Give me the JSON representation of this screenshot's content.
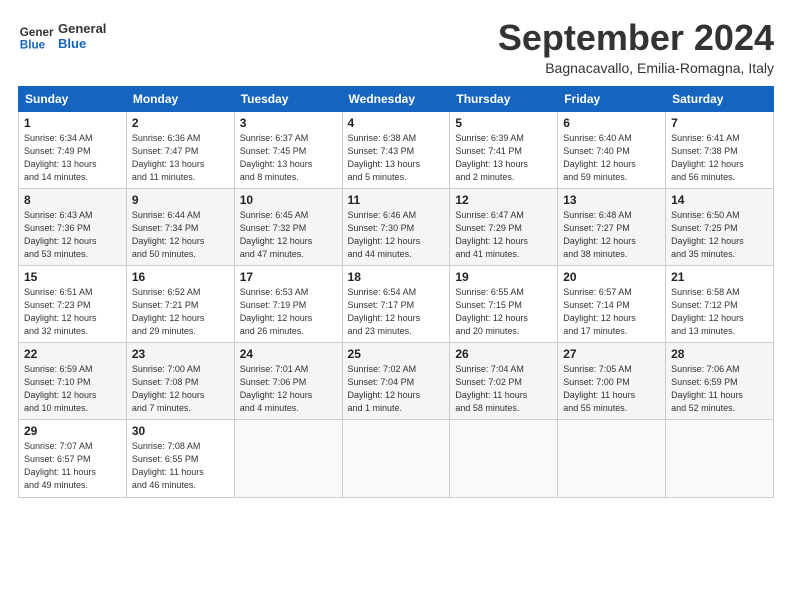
{
  "logo": {
    "line1": "General",
    "line2": "Blue"
  },
  "title": "September 2024",
  "location": "Bagnacavallo, Emilia-Romagna, Italy",
  "days_of_week": [
    "Sunday",
    "Monday",
    "Tuesday",
    "Wednesday",
    "Thursday",
    "Friday",
    "Saturday"
  ],
  "weeks": [
    [
      {
        "day": "1",
        "info": "Sunrise: 6:34 AM\nSunset: 7:49 PM\nDaylight: 13 hours\nand 14 minutes."
      },
      {
        "day": "2",
        "info": "Sunrise: 6:36 AM\nSunset: 7:47 PM\nDaylight: 13 hours\nand 11 minutes."
      },
      {
        "day": "3",
        "info": "Sunrise: 6:37 AM\nSunset: 7:45 PM\nDaylight: 13 hours\nand 8 minutes."
      },
      {
        "day": "4",
        "info": "Sunrise: 6:38 AM\nSunset: 7:43 PM\nDaylight: 13 hours\nand 5 minutes."
      },
      {
        "day": "5",
        "info": "Sunrise: 6:39 AM\nSunset: 7:41 PM\nDaylight: 13 hours\nand 2 minutes."
      },
      {
        "day": "6",
        "info": "Sunrise: 6:40 AM\nSunset: 7:40 PM\nDaylight: 12 hours\nand 59 minutes."
      },
      {
        "day": "7",
        "info": "Sunrise: 6:41 AM\nSunset: 7:38 PM\nDaylight: 12 hours\nand 56 minutes."
      }
    ],
    [
      {
        "day": "8",
        "info": "Sunrise: 6:43 AM\nSunset: 7:36 PM\nDaylight: 12 hours\nand 53 minutes."
      },
      {
        "day": "9",
        "info": "Sunrise: 6:44 AM\nSunset: 7:34 PM\nDaylight: 12 hours\nand 50 minutes."
      },
      {
        "day": "10",
        "info": "Sunrise: 6:45 AM\nSunset: 7:32 PM\nDaylight: 12 hours\nand 47 minutes."
      },
      {
        "day": "11",
        "info": "Sunrise: 6:46 AM\nSunset: 7:30 PM\nDaylight: 12 hours\nand 44 minutes."
      },
      {
        "day": "12",
        "info": "Sunrise: 6:47 AM\nSunset: 7:29 PM\nDaylight: 12 hours\nand 41 minutes."
      },
      {
        "day": "13",
        "info": "Sunrise: 6:48 AM\nSunset: 7:27 PM\nDaylight: 12 hours\nand 38 minutes."
      },
      {
        "day": "14",
        "info": "Sunrise: 6:50 AM\nSunset: 7:25 PM\nDaylight: 12 hours\nand 35 minutes."
      }
    ],
    [
      {
        "day": "15",
        "info": "Sunrise: 6:51 AM\nSunset: 7:23 PM\nDaylight: 12 hours\nand 32 minutes."
      },
      {
        "day": "16",
        "info": "Sunrise: 6:52 AM\nSunset: 7:21 PM\nDaylight: 12 hours\nand 29 minutes."
      },
      {
        "day": "17",
        "info": "Sunrise: 6:53 AM\nSunset: 7:19 PM\nDaylight: 12 hours\nand 26 minutes."
      },
      {
        "day": "18",
        "info": "Sunrise: 6:54 AM\nSunset: 7:17 PM\nDaylight: 12 hours\nand 23 minutes."
      },
      {
        "day": "19",
        "info": "Sunrise: 6:55 AM\nSunset: 7:15 PM\nDaylight: 12 hours\nand 20 minutes."
      },
      {
        "day": "20",
        "info": "Sunrise: 6:57 AM\nSunset: 7:14 PM\nDaylight: 12 hours\nand 17 minutes."
      },
      {
        "day": "21",
        "info": "Sunrise: 6:58 AM\nSunset: 7:12 PM\nDaylight: 12 hours\nand 13 minutes."
      }
    ],
    [
      {
        "day": "22",
        "info": "Sunrise: 6:59 AM\nSunset: 7:10 PM\nDaylight: 12 hours\nand 10 minutes."
      },
      {
        "day": "23",
        "info": "Sunrise: 7:00 AM\nSunset: 7:08 PM\nDaylight: 12 hours\nand 7 minutes."
      },
      {
        "day": "24",
        "info": "Sunrise: 7:01 AM\nSunset: 7:06 PM\nDaylight: 12 hours\nand 4 minutes."
      },
      {
        "day": "25",
        "info": "Sunrise: 7:02 AM\nSunset: 7:04 PM\nDaylight: 12 hours\nand 1 minute."
      },
      {
        "day": "26",
        "info": "Sunrise: 7:04 AM\nSunset: 7:02 PM\nDaylight: 11 hours\nand 58 minutes."
      },
      {
        "day": "27",
        "info": "Sunrise: 7:05 AM\nSunset: 7:00 PM\nDaylight: 11 hours\nand 55 minutes."
      },
      {
        "day": "28",
        "info": "Sunrise: 7:06 AM\nSunset: 6:59 PM\nDaylight: 11 hours\nand 52 minutes."
      }
    ],
    [
      {
        "day": "29",
        "info": "Sunrise: 7:07 AM\nSunset: 6:57 PM\nDaylight: 11 hours\nand 49 minutes."
      },
      {
        "day": "30",
        "info": "Sunrise: 7:08 AM\nSunset: 6:55 PM\nDaylight: 11 hours\nand 46 minutes."
      },
      {
        "day": "",
        "info": ""
      },
      {
        "day": "",
        "info": ""
      },
      {
        "day": "",
        "info": ""
      },
      {
        "day": "",
        "info": ""
      },
      {
        "day": "",
        "info": ""
      }
    ]
  ]
}
